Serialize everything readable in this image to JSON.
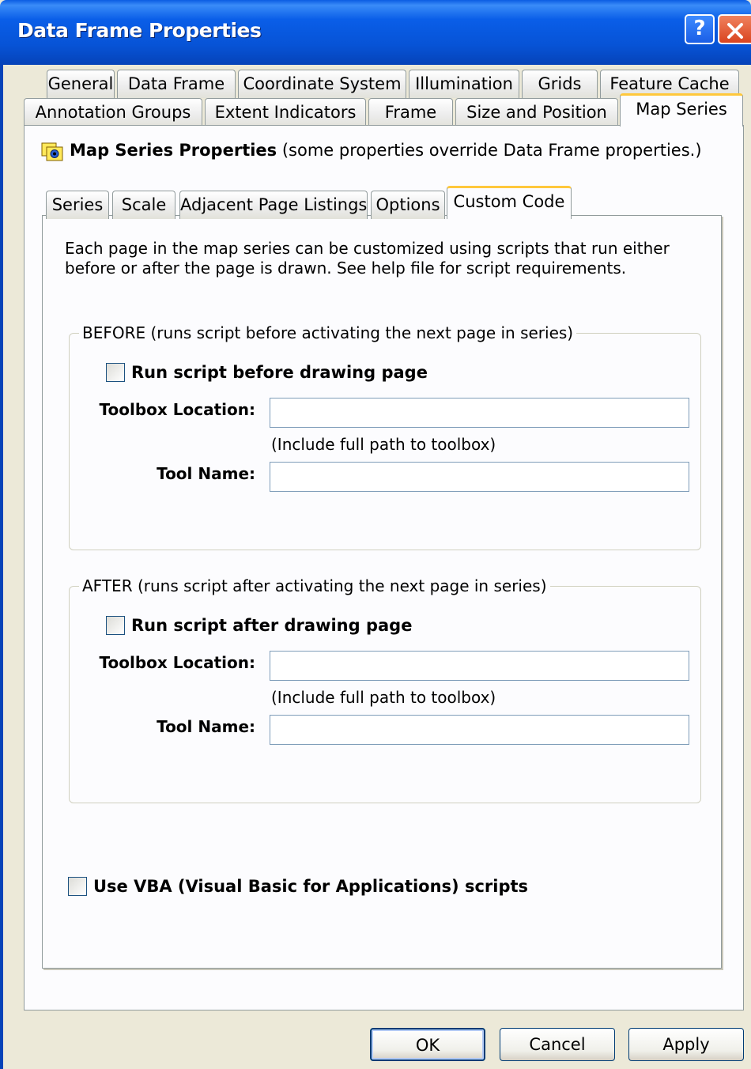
{
  "window": {
    "title": "Data Frame Properties",
    "help_glyph": "?",
    "close_icon": "close-icon"
  },
  "tabs_row1": [
    "General",
    "Data Frame",
    "Coordinate System",
    "Illumination",
    "Grids",
    "Feature Cache"
  ],
  "tabs_row2": [
    "Annotation Groups",
    "Extent Indicators",
    "Frame",
    "Size and Position",
    "Map Series"
  ],
  "active_tab": "Map Series",
  "heading": {
    "bold": "Map Series Properties",
    "note": " (some properties override Data Frame properties.)"
  },
  "inner_tabs": [
    "Series",
    "Scale",
    "Adjacent Page Listings",
    "Options",
    "Custom Code"
  ],
  "active_inner_tab": "Custom Code",
  "description": "Each page in the map series can be customized using scripts that run either before or after the page is drawn. See help file for script requirements.",
  "before": {
    "legend": "BEFORE (runs script before activating the next page in series)",
    "checkbox_label": "Run script before drawing page",
    "checked": false,
    "toolbox_label": "Toolbox Location:",
    "toolbox_value": "",
    "hint": "(Include full path to toolbox)",
    "tool_label": "Tool Name:",
    "tool_value": ""
  },
  "after": {
    "legend": "AFTER (runs script after activating the next page in series)",
    "checkbox_label": "Run script after drawing page",
    "checked": false,
    "toolbox_label": "Toolbox Location:",
    "toolbox_value": "",
    "hint": "(Include full path to toolbox)",
    "tool_label": "Tool Name:",
    "tool_value": ""
  },
  "vba": {
    "label": "Use VBA (Visual Basic for Applications) scripts",
    "checked": false
  },
  "buttons": {
    "ok": "OK",
    "cancel": "Cancel",
    "apply": "Apply"
  },
  "colors": {
    "titlebar": "#0a5ce3",
    "dialog_bg": "#ece9d8",
    "active_tab_accent": "#ffc83c"
  }
}
